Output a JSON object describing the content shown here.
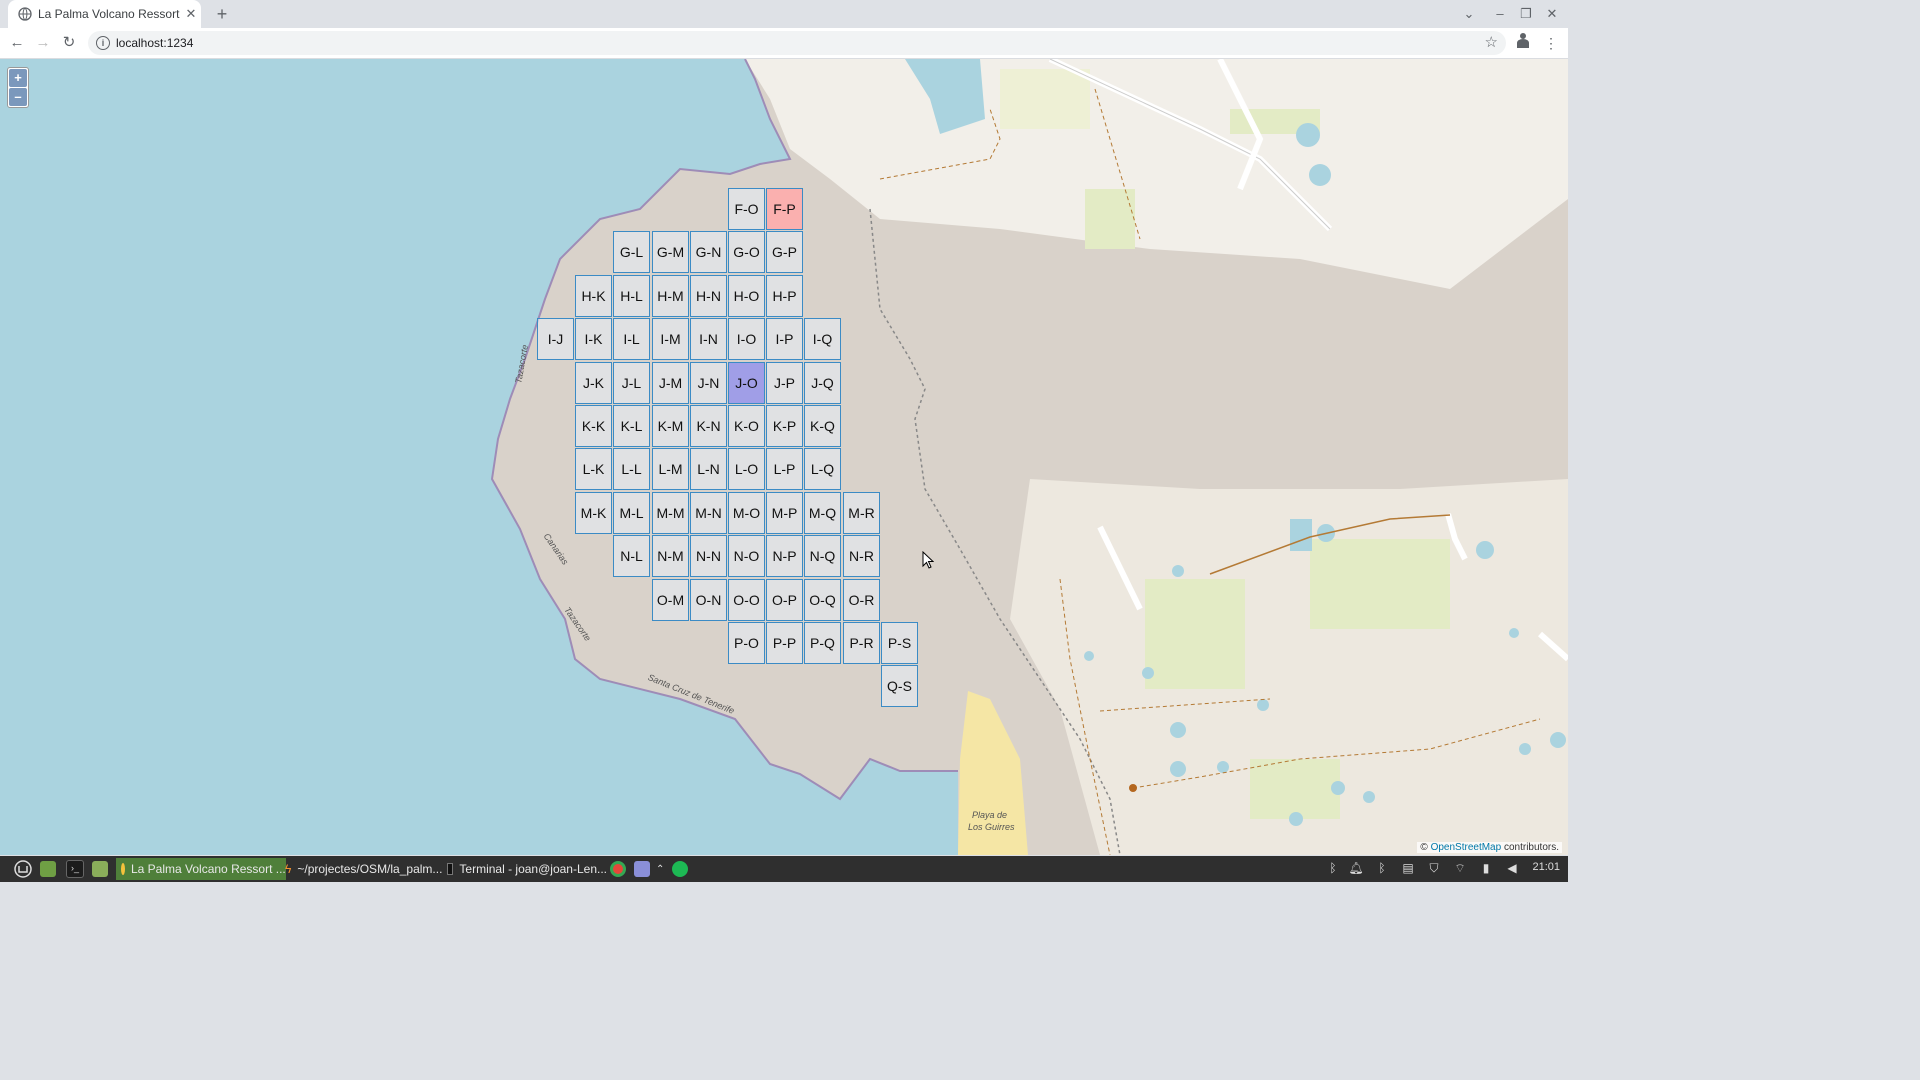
{
  "browser": {
    "tab_title": "La Palma Volcano Ressort",
    "url": "localhost:1234"
  },
  "map": {
    "zoom_in": "+",
    "zoom_out": "–",
    "attribution_prefix": "©",
    "attribution_link": "OpenStreetMap",
    "attribution_suffix": "contributors.",
    "place_labels": [
      "Tazacorte",
      "Canarias",
      "Tazacorte",
      "Santa Cruz de Tenerife",
      "Playa de",
      "Los Guirres"
    ],
    "grid": {
      "F": [
        "O",
        "P"
      ],
      "G": [
        "L",
        "M",
        "N",
        "O",
        "P"
      ],
      "H": [
        "K",
        "L",
        "M",
        "N",
        "O",
        "P"
      ],
      "I": [
        "J",
        "K",
        "L",
        "M",
        "N",
        "O",
        "P",
        "Q"
      ],
      "J": [
        "K",
        "L",
        "M",
        "N",
        "O",
        "P",
        "Q"
      ],
      "K": [
        "K",
        "L",
        "M",
        "N",
        "O",
        "P",
        "Q"
      ],
      "L": [
        "K",
        "L",
        "M",
        "N",
        "O",
        "P",
        "Q"
      ],
      "M": [
        "K",
        "L",
        "M",
        "N",
        "O",
        "P",
        "Q",
        "R"
      ],
      "N": [
        "L",
        "M",
        "N",
        "O",
        "P",
        "Q",
        "R"
      ],
      "O": [
        "M",
        "N",
        "O",
        "P",
        "Q",
        "R"
      ],
      "P": [
        "O",
        "P",
        "Q",
        "R",
        "S"
      ],
      "Q": [
        "S"
      ]
    },
    "highlighted_cell": "F-P",
    "selected_cell": "J-O",
    "colors": {
      "water": "#aad3df",
      "land": "#f2efe9",
      "rock": "#d6cfc7",
      "highlight": "#ffaaaa",
      "selected": "#8c8cf0",
      "grid_border": "#3b8bc5"
    }
  },
  "taskbar": {
    "tasks": [
      {
        "label": "La Palma Volcano Ressort ...",
        "active": true
      },
      {
        "label": "~/projectes/OSM/la_palm...",
        "active": false
      },
      {
        "label": "Terminal - joan@joan-Len...",
        "active": false
      }
    ],
    "clock": "21:01"
  }
}
